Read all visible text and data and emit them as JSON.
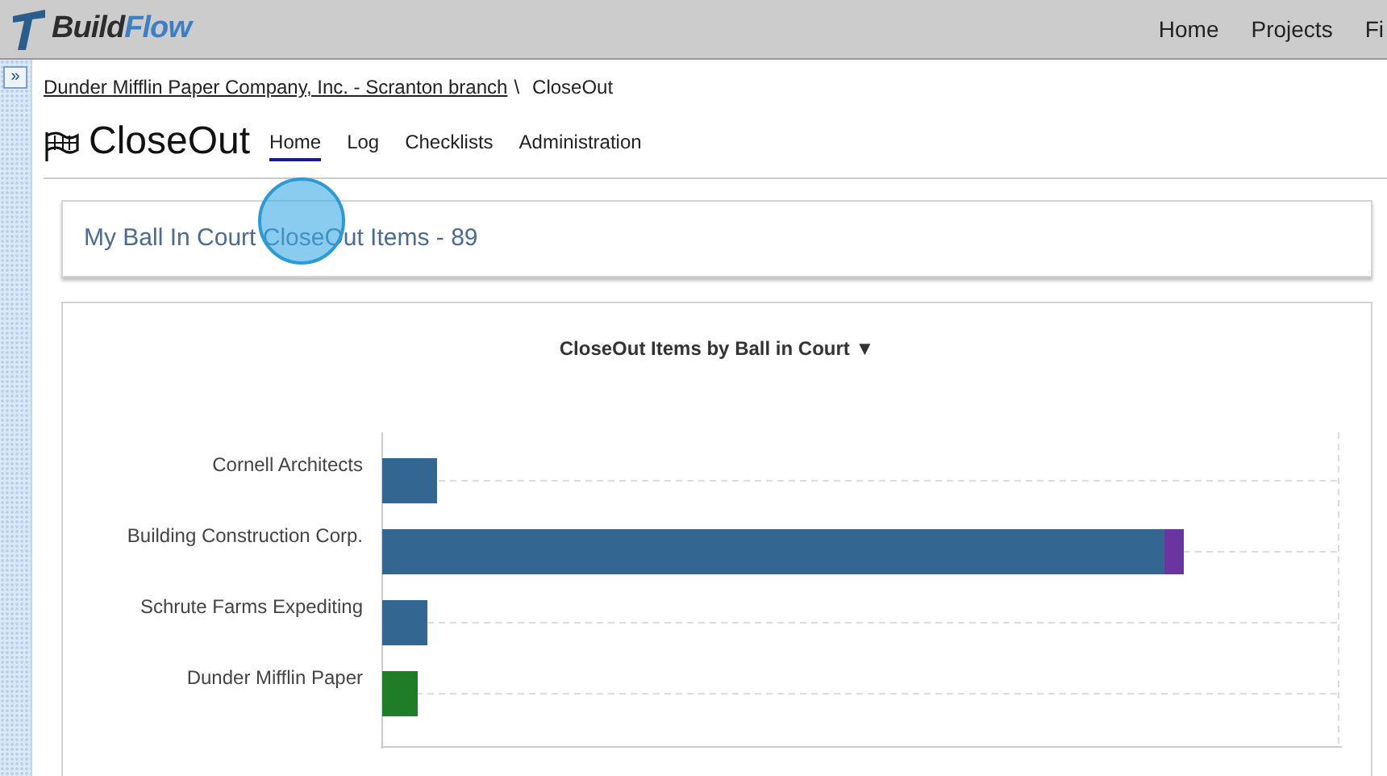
{
  "app": {
    "brand_first": "Build",
    "brand_second": "Flow"
  },
  "top_nav": [
    {
      "label": "Home"
    },
    {
      "label": "Projects"
    },
    {
      "label": "Fi"
    }
  ],
  "sidebar_toggle": {
    "label": "»"
  },
  "breadcrumb": {
    "link": "Dunder Mifflin Paper Company, Inc. - Scranton branch",
    "separator": "\\",
    "current": "CloseOut"
  },
  "module": {
    "title": "CloseOut"
  },
  "tabs": [
    {
      "label": "Home",
      "selected": true
    },
    {
      "label": "Log",
      "selected": false
    },
    {
      "label": "Checklists",
      "selected": false
    },
    {
      "label": "Administration",
      "selected": false
    }
  ],
  "ball_in_court": {
    "heading": "My Ball In Court CloseOut Items - 89"
  },
  "chart": {
    "title": "CloseOut Items by Ball in Court ▼",
    "categories": [
      "Cornell Architects",
      "Building Construction Corp.",
      "Schrute Farms Expediting",
      "Dunder Mifflin Paper"
    ]
  }
}
